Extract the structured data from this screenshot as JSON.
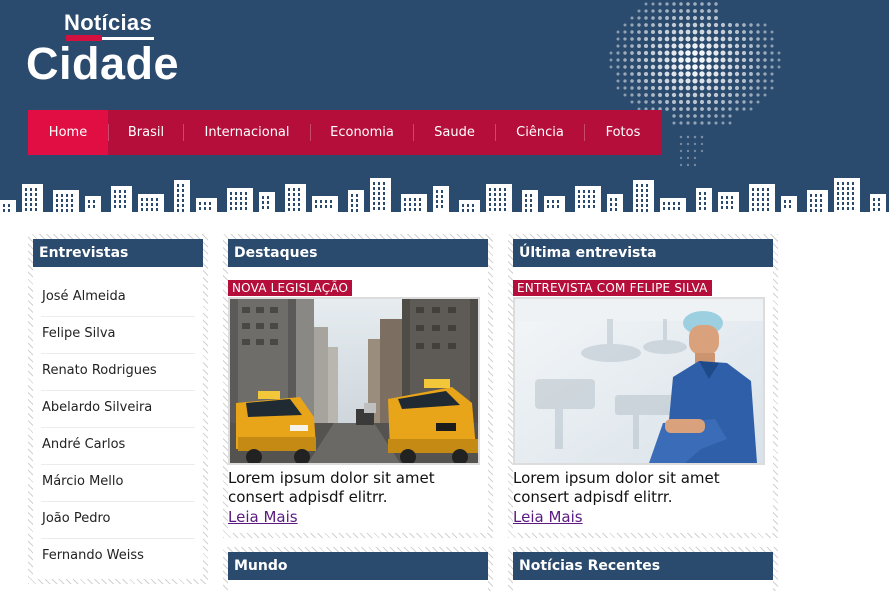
{
  "brand": {
    "small": "Notícias",
    "big": "Cidade"
  },
  "nav": [
    {
      "label": "Home",
      "active": true
    },
    {
      "label": "Brasil"
    },
    {
      "label": "Internacional"
    },
    {
      "label": "Economia"
    },
    {
      "label": "Saude"
    },
    {
      "label": "Ciência"
    },
    {
      "label": "Fotos"
    }
  ],
  "colors": {
    "header_bg": "#2a4a6e",
    "accent": "#b50e3a",
    "accent_active": "#e00e43"
  },
  "entrevistas": {
    "title": "Entrevistas",
    "items": [
      "José Almeida",
      "Felipe Silva",
      "Renato Rodrigues",
      "Abelardo Silveira",
      "André Carlos",
      "Márcio Mello",
      "João Pedro",
      "Fernando Weiss"
    ]
  },
  "destaques": {
    "title": "Destaques",
    "tag": "NOVA LEGISLAÇÃO",
    "text": "Lorem ipsum dolor sit amet consert adpisdf elitrr.",
    "link": "Leia Mais",
    "image": "city-taxis-photo"
  },
  "ultima": {
    "title": "Última entrevista",
    "tag": "ENTREVISTA COM FELIPE SILVA",
    "text": "Lorem ipsum dolor sit amet consert adpisdf elitrr.",
    "link": "Leia Mais",
    "image": "doctor-photo"
  },
  "mundo": {
    "title": "Mundo"
  },
  "recentes": {
    "title": "Notícias Recentes"
  }
}
